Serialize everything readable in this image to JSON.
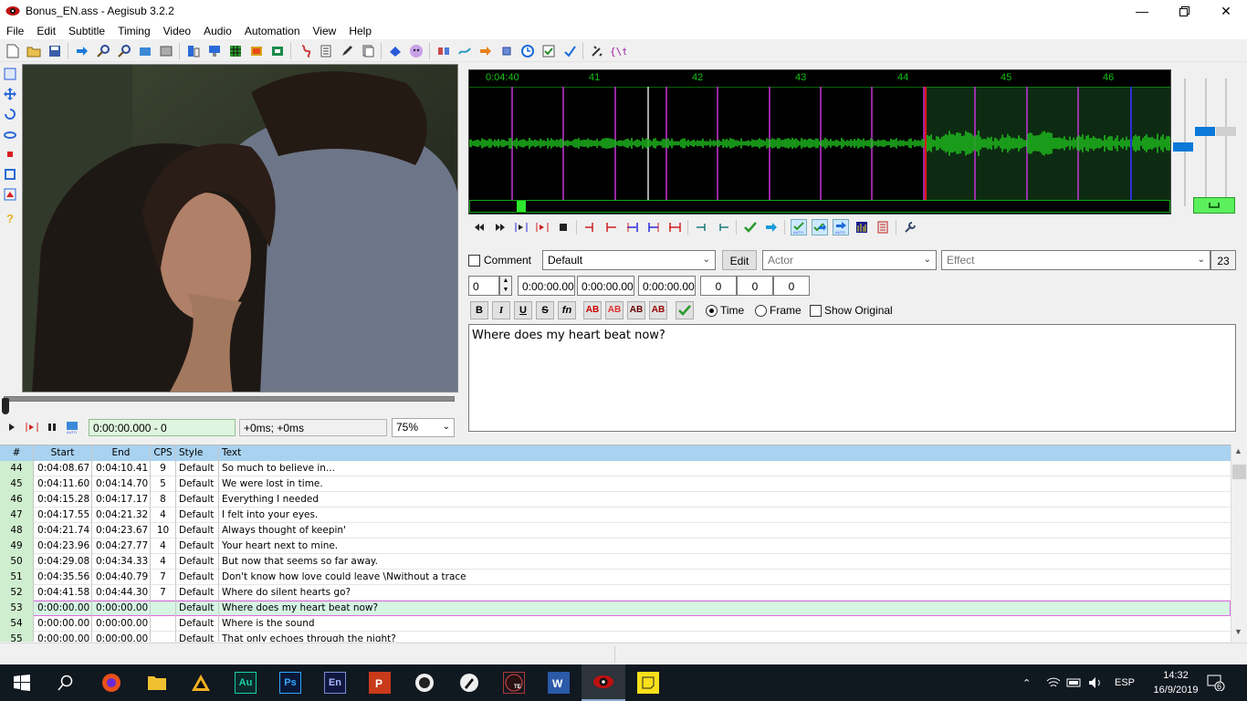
{
  "window": {
    "title": "Bonus_EN.ass - Aegisub 3.2.2"
  },
  "menu": [
    "File",
    "Edit",
    "Subtitle",
    "Timing",
    "Video",
    "Audio",
    "Automation",
    "View",
    "Help"
  ],
  "video_controls": {
    "time": "0:00:00.000 - 0",
    "offset": "+0ms; +0ms",
    "zoom": "75%"
  },
  "audio": {
    "ruler_labels": [
      "0:04:40",
      "41",
      "42",
      "43",
      "44",
      "45",
      "46"
    ],
    "colors": {
      "waveform": "#1db81d",
      "ruler": "#14c314",
      "selection": "#0d2b12",
      "keyframe": "#c832d8",
      "start_marker": "#e01818",
      "end_marker": "#2d2dd8"
    }
  },
  "edit": {
    "comment_label": "Comment",
    "style": "Default",
    "edit_button": "Edit",
    "actor_placeholder": "Actor",
    "effect_placeholder": "Effect",
    "char_count": "23",
    "layer": "0",
    "start": "0:00:00.00",
    "end": "0:00:00.00",
    "duration": "0:00:00.00",
    "margin_l": "0",
    "margin_r": "0",
    "margin_v": "0",
    "bold": "B",
    "italic": "I",
    "underline": "U",
    "strike": "S",
    "fn": "fn",
    "ab": "AB",
    "time_label": "Time",
    "frame_label": "Frame",
    "show_original_label": "Show Original",
    "text": "Where does my heart beat now?"
  },
  "grid": {
    "headers": [
      "#",
      "Start",
      "End",
      "CPS",
      "Style",
      "Text"
    ],
    "rows": [
      {
        "num": "44",
        "start": "0:04:08.67",
        "end": "0:04:10.41",
        "cps": "9",
        "style": "Default",
        "text": "So much to believe in..."
      },
      {
        "num": "45",
        "start": "0:04:11.60",
        "end": "0:04:14.70",
        "cps": "5",
        "style": "Default",
        "text": "We were lost in time."
      },
      {
        "num": "46",
        "start": "0:04:15.28",
        "end": "0:04:17.17",
        "cps": "8",
        "style": "Default",
        "text": "Everything I needed"
      },
      {
        "num": "47",
        "start": "0:04:17.55",
        "end": "0:04:21.32",
        "cps": "4",
        "style": "Default",
        "text": "I felt into your eyes."
      },
      {
        "num": "48",
        "start": "0:04:21.74",
        "end": "0:04:23.67",
        "cps": "10",
        "style": "Default",
        "text": "Always thought of keepin'"
      },
      {
        "num": "49",
        "start": "0:04:23.96",
        "end": "0:04:27.77",
        "cps": "4",
        "style": "Default",
        "text": "Your heart next to mine."
      },
      {
        "num": "50",
        "start": "0:04:29.08",
        "end": "0:04:34.33",
        "cps": "4",
        "style": "Default",
        "text": "But now that seems so far away."
      },
      {
        "num": "51",
        "start": "0:04:35.56",
        "end": "0:04:40.79",
        "cps": "7",
        "style": "Default",
        "text": "Don't know how love could leave \\Nwithout a trace"
      },
      {
        "num": "52",
        "start": "0:04:41.58",
        "end": "0:04:44.30",
        "cps": "7",
        "style": "Default",
        "text": "Where do silent hearts go?"
      },
      {
        "num": "53",
        "start": "0:00:00.00",
        "end": "0:00:00.00",
        "cps": "",
        "style": "Default",
        "text": "Where does my heart beat now?"
      },
      {
        "num": "54",
        "start": "0:00:00.00",
        "end": "0:00:00.00",
        "cps": "",
        "style": "Default",
        "text": "Where is the sound"
      },
      {
        "num": "55",
        "start": "0:00:00.00",
        "end": "0:00:00.00",
        "cps": "",
        "style": "Default",
        "text": "That only echoes through the night?"
      }
    ]
  },
  "taskbar": {
    "apps": [
      "Au",
      "Ps",
      "En",
      "TE"
    ],
    "language": "ESP",
    "time": "14:32",
    "date": "16/9/2019",
    "notifications": "6"
  }
}
